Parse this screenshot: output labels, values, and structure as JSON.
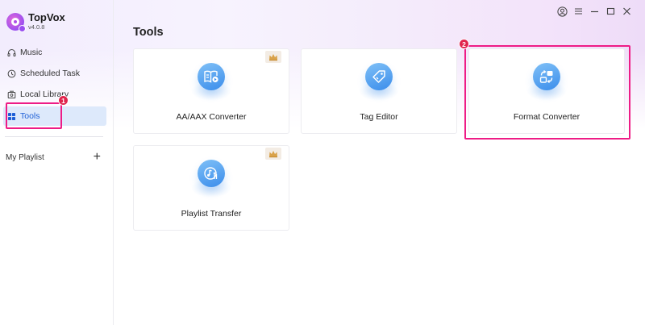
{
  "app": {
    "name": "TopVox",
    "version": "v4.0.8"
  },
  "sidebar": {
    "items": [
      {
        "label": "Music",
        "icon": "headphones-icon"
      },
      {
        "label": "Scheduled Task",
        "icon": "clock-icon"
      },
      {
        "label": "Local Library",
        "icon": "library-icon"
      },
      {
        "label": "Tools",
        "icon": "grid-icon",
        "active": true
      }
    ],
    "playlist_label": "My Playlist",
    "add_symbol": "+"
  },
  "main": {
    "title": "Tools",
    "cards": [
      {
        "label": "AA/AAX Converter",
        "icon": "audiobook-icon",
        "premium": true
      },
      {
        "label": "Tag Editor",
        "icon": "tag-icon",
        "premium": false
      },
      {
        "label": "Format Converter",
        "icon": "format-convert-icon",
        "premium": false
      },
      {
        "label": "Playlist Transfer",
        "icon": "music-transfer-icon",
        "premium": true
      }
    ]
  },
  "annotations": {
    "badge1": "1",
    "badge2": "2"
  },
  "colors": {
    "accent": "#1e5fd6",
    "highlight": "#ee1c86",
    "badge": "#e0254d",
    "icon_blue": "#3b8deb"
  }
}
